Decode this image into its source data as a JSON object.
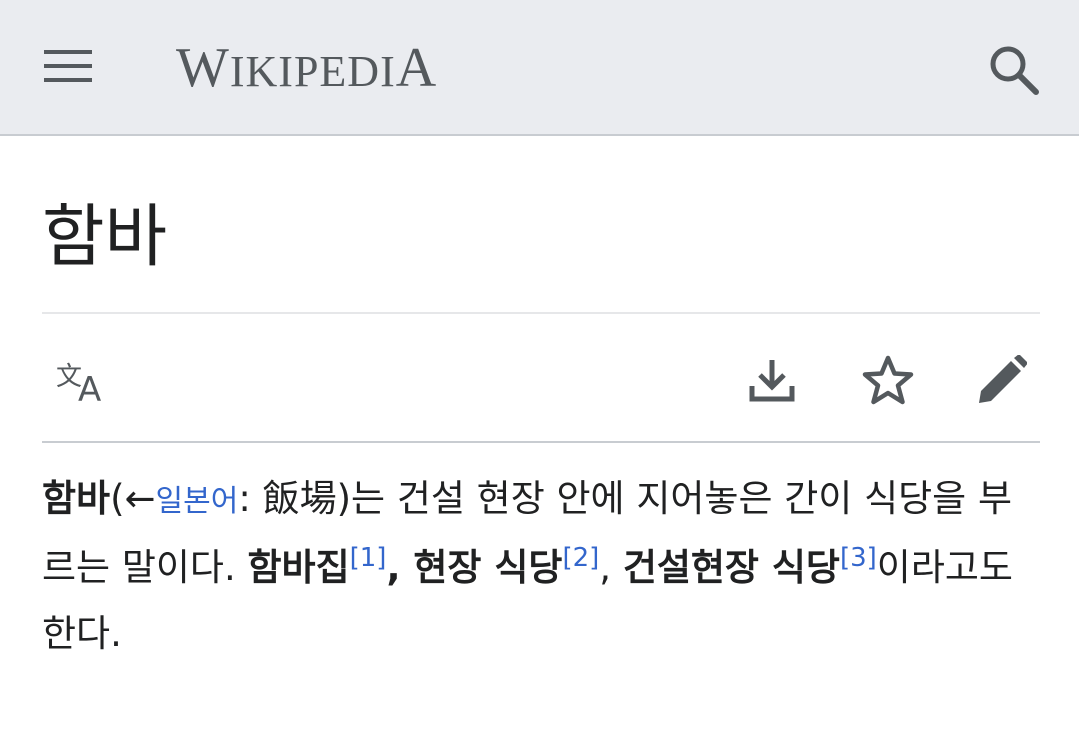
{
  "header": {
    "logo_first": "W",
    "logo_middle": "IKIPEDI",
    "logo_last": "A",
    "menu_icon": "hamburger-menu-icon",
    "search_icon": "search-icon"
  },
  "page": {
    "title": "함바"
  },
  "actions": {
    "language_icon": "language-icon",
    "download_icon": "download-icon",
    "watch_icon": "star-icon",
    "edit_icon": "pencil-edit-icon"
  },
  "article": {
    "term": "함바",
    "open_paren": "(←",
    "lang_link": "일본어",
    "colon": ": ",
    "original": "飯場",
    "close_text": ")는 건설 현장 안에 지어놓은 간이 식당을 부르는 말이다. ",
    "alt1": "함바집",
    "ref1": "[1]",
    "sep1": ", ",
    "alt2": "현장 식당",
    "ref2": "[2]",
    "sep2": ", ",
    "alt3": "건설현장 식당",
    "ref3": "[3]",
    "tail": "이라고도 한다."
  },
  "colors": {
    "header_bg": "#eaecf0",
    "link": "#3366cc",
    "icon": "#54595d",
    "text": "#202122"
  }
}
